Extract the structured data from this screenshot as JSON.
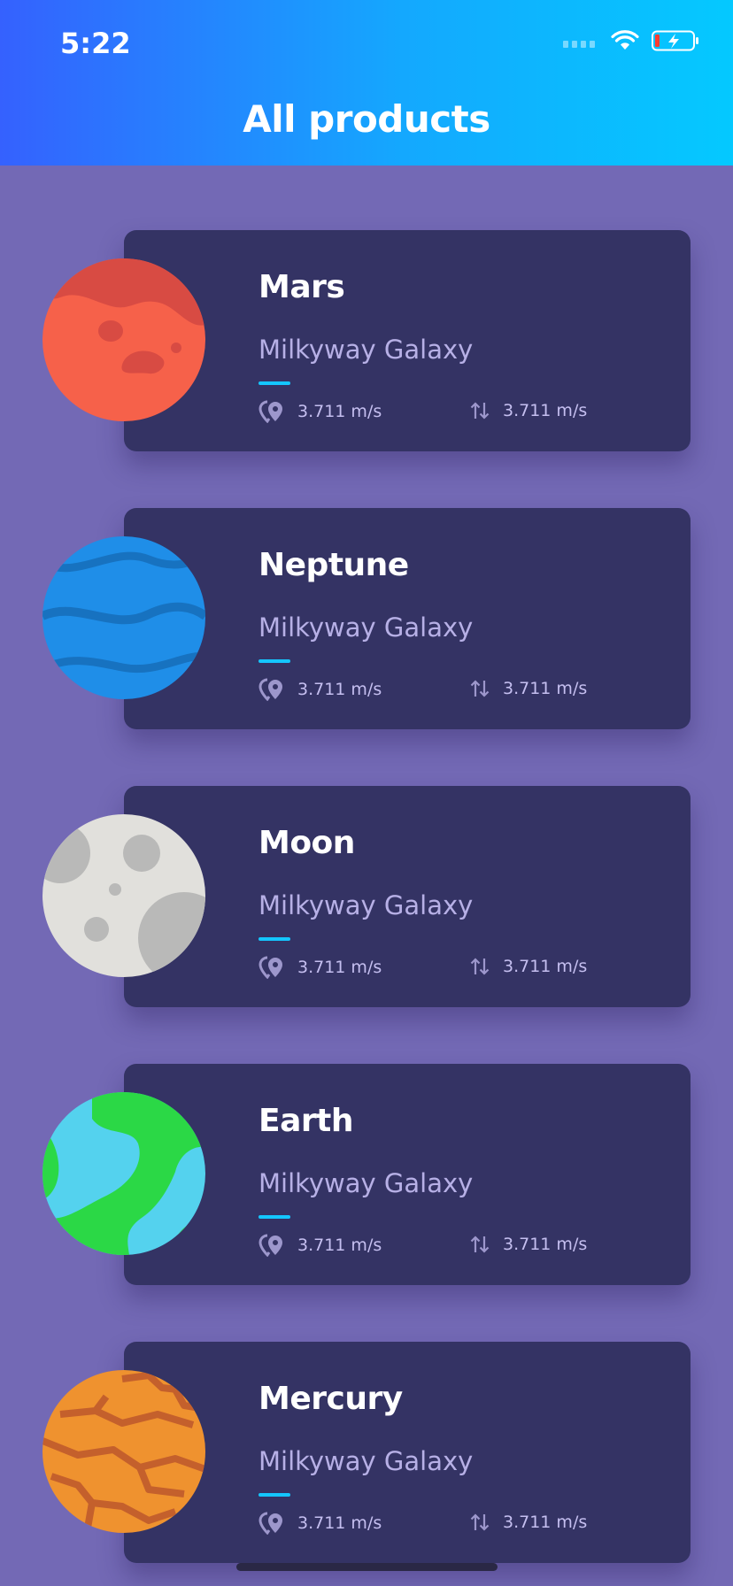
{
  "status": {
    "time": "5:22"
  },
  "header": {
    "title": "All products"
  },
  "products": [
    {
      "name": "Mars",
      "galaxy": "Milkyway Galaxy",
      "stat1": "3.711 m/s",
      "stat2": "3.711 m/s"
    },
    {
      "name": "Neptune",
      "galaxy": "Milkyway Galaxy",
      "stat1": "3.711 m/s",
      "stat2": "3.711 m/s"
    },
    {
      "name": "Moon",
      "galaxy": "Milkyway Galaxy",
      "stat1": "3.711 m/s",
      "stat2": "3.711 m/s"
    },
    {
      "name": "Earth",
      "galaxy": "Milkyway Galaxy",
      "stat1": "3.711 m/s",
      "stat2": "3.711 m/s"
    },
    {
      "name": "Mercury",
      "galaxy": "Milkyway Galaxy",
      "stat1": "3.711 m/s",
      "stat2": "3.711 m/s"
    }
  ],
  "colors": {
    "accent": "#14c6ff",
    "card": "#343364",
    "background": "#7369b5"
  },
  "icons": {
    "stat1": "location-pin-icon",
    "stat2": "arrows-up-down-icon"
  }
}
